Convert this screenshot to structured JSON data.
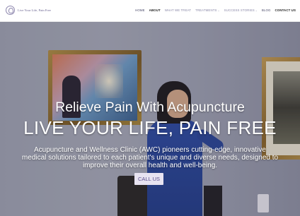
{
  "brand": {
    "logo_text": "Live Your Life, Pain Free",
    "logo_icon": "lotus-logo-icon"
  },
  "nav": {
    "items": [
      {
        "label": "HOME"
      },
      {
        "label": "ABOUT"
      },
      {
        "label": "WHAT WE TREAT"
      },
      {
        "label": "TREATMENTS",
        "caret": "⌄"
      },
      {
        "label": "SUCCESS STORIES",
        "caret": "⌄"
      },
      {
        "label": "BLOG"
      },
      {
        "label": "CONTACT US"
      }
    ]
  },
  "hero": {
    "tagline": "Relieve Pain With Acupuncture",
    "headline": "LIVE YOUR LIFE, PAIN FREE",
    "description": "Acupuncture and Wellness Clinic (AWC) pioneers cutting-edge, innovative medical solutions tailored to each patient's unique and diverse needs, designed to improve their overall health and well-being.",
    "cta_label": "CALL US"
  },
  "colors": {
    "accent": "#5a4e8c",
    "button_bg": "#e7e3f1",
    "nav_text": "#4a4a6a"
  }
}
